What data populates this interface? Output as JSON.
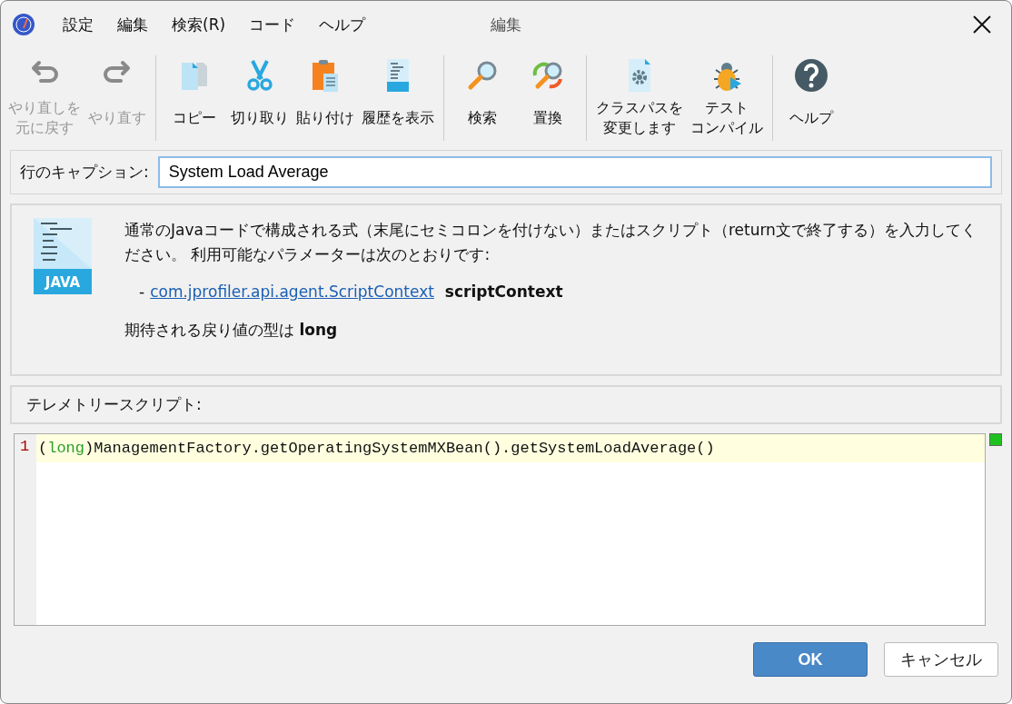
{
  "window": {
    "title": "編集"
  },
  "menu": [
    "設定",
    "編集",
    "検索(R)",
    "コード",
    "ヘルプ"
  ],
  "toolbar": [
    [
      {
        "label": [
          "やり直しを",
          "元に戻す"
        ],
        "disabled": true
      },
      {
        "label": [
          "やり直す"
        ],
        "disabled": true
      }
    ],
    [
      {
        "label": [
          "コピー"
        ],
        "disabled": false
      },
      {
        "label": [
          "切り取り"
        ],
        "disabled": false
      },
      {
        "label": [
          "貼り付け"
        ],
        "disabled": false
      },
      {
        "label": [
          "履歴を表示"
        ],
        "disabled": false
      }
    ],
    [
      {
        "label": [
          "検索"
        ],
        "disabled": false
      },
      {
        "label": [
          "置換"
        ],
        "disabled": false
      }
    ],
    [
      {
        "label": [
          "クラスパスを",
          "変更します"
        ],
        "disabled": false
      },
      {
        "label": [
          "テスト",
          "コンパイル"
        ],
        "disabled": false
      }
    ],
    [
      {
        "label": [
          "ヘルプ"
        ],
        "disabled": false
      }
    ]
  ],
  "caption": {
    "label": "行のキャプション:",
    "value": "System Load Average"
  },
  "info": {
    "icon_text": "JAVA",
    "description": "通常のJavaコードで構成される式（末尾にセミコロンを付けない）またはスクリプト（return文で終了する）を入力してください。 利用可能なパラメーターは次のとおりです:",
    "parameter_prefix": "-",
    "parameter_type": "com.jprofiler.api.agent.ScriptContext",
    "parameter_name": "scriptContext",
    "return_type": "期待される戻り値の型は **long**"
  },
  "script_label": "テレメトリースクリプト:",
  "editor": {
    "status_ok": true,
    "lines": [
      {
        "number": "1",
        "tokens": [
          {
            "kind": "plain",
            "text": "("
          },
          {
            "kind": "keyword",
            "text": "long"
          },
          {
            "kind": "plain",
            "text": ")ManagementFactory.getOperatingSystemMXBean().getSystemLoadAverage()"
          }
        ]
      }
    ]
  },
  "buttons": [
    {
      "label": "OK",
      "default": true
    },
    {
      "label": "キャンセル",
      "default": false
    }
  ]
}
